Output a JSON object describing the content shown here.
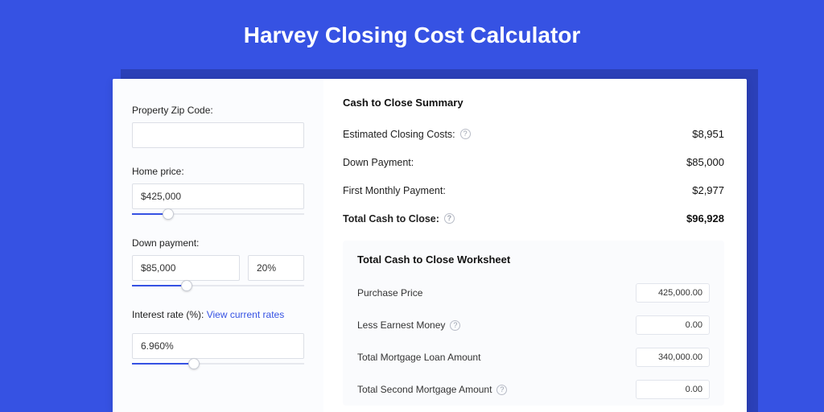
{
  "title": "Harvey Closing Cost Calculator",
  "left": {
    "zip_label": "Property Zip Code:",
    "zip_value": "",
    "home_price_label": "Home price:",
    "home_price_value": "$425,000",
    "down_payment_label": "Down payment:",
    "down_payment_amount": "$85,000",
    "down_payment_percent": "20%",
    "interest_label": "Interest rate (%):",
    "interest_link": "View current rates",
    "interest_value": "6.960%",
    "slider_home_fill_pct": 21,
    "slider_down_fill_pct": 32,
    "slider_interest_fill_pct": 36
  },
  "summary": {
    "title": "Cash to Close Summary",
    "rows": [
      {
        "label": "Estimated Closing Costs:",
        "value": "$8,951",
        "help": true
      },
      {
        "label": "Down Payment:",
        "value": "$85,000",
        "help": false
      },
      {
        "label": "First Monthly Payment:",
        "value": "$2,977",
        "help": false
      }
    ],
    "total_label": "Total Cash to Close:",
    "total_value": "$96,928"
  },
  "worksheet": {
    "title": "Total Cash to Close Worksheet",
    "rows": [
      {
        "label": "Purchase Price",
        "value": "425,000.00",
        "help": false
      },
      {
        "label": "Less Earnest Money",
        "value": "0.00",
        "help": true
      },
      {
        "label": "Total Mortgage Loan Amount",
        "value": "340,000.00",
        "help": false
      },
      {
        "label": "Total Second Mortgage Amount",
        "value": "0.00",
        "help": true
      }
    ]
  }
}
